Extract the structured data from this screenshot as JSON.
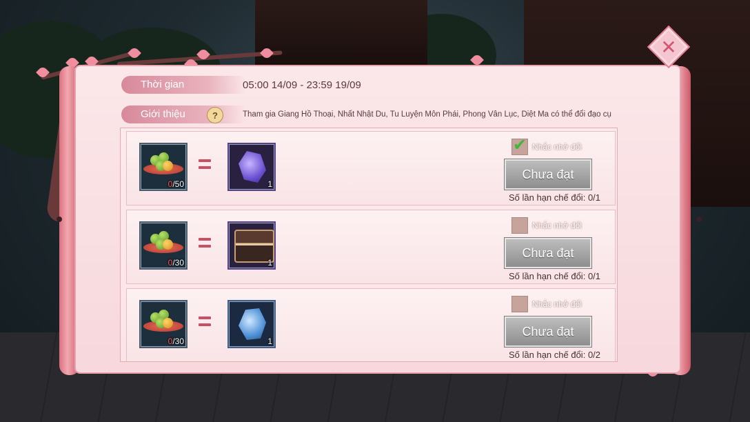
{
  "header": {
    "time_label": "Thời gian",
    "time_value": "05:00 14/09 - 23:59 19/09",
    "intro_label": "Giới thiệu",
    "intro_help": "?",
    "intro_value": "Tham gia Giang Hồ Thoại, Nhất Nhật Du, Tu Luyện Môn Phái, Phong Vân Lục, Diệt Ma có thể đổi đạo cụ"
  },
  "close_icon": "✕",
  "rows": [
    {
      "cost": {
        "current": "0",
        "total": "/50",
        "icon": "green-fruit-plate-icon"
      },
      "reward": {
        "count": "1",
        "icon": "purple-gem-icon"
      },
      "remind_label": "Nhắc nhở đổi",
      "remind_checked": true,
      "status": "Chưa đạt",
      "limit_label": "Số lần hạn chế đổi:",
      "limit_value": "0/1"
    },
    {
      "cost": {
        "current": "0",
        "total": "/30",
        "icon": "green-fruit-plate-icon"
      },
      "reward": {
        "count": "1",
        "icon": "treasure-chest-icon"
      },
      "remind_label": "Nhắc nhở đổi",
      "remind_checked": false,
      "status": "Chưa đạt",
      "limit_label": "Số lần hạn chế đổi:",
      "limit_value": "0/1"
    },
    {
      "cost": {
        "current": "0",
        "total": "/30",
        "icon": "green-fruit-plate-icon"
      },
      "reward": {
        "count": "1",
        "icon": "blue-gem-icon"
      },
      "remind_label": "Nhắc nhở đổi",
      "remind_checked": false,
      "status": "Chưa đạt",
      "limit_label": "Số lần hạn chế đổi:",
      "limit_value": "0/2"
    }
  ]
}
